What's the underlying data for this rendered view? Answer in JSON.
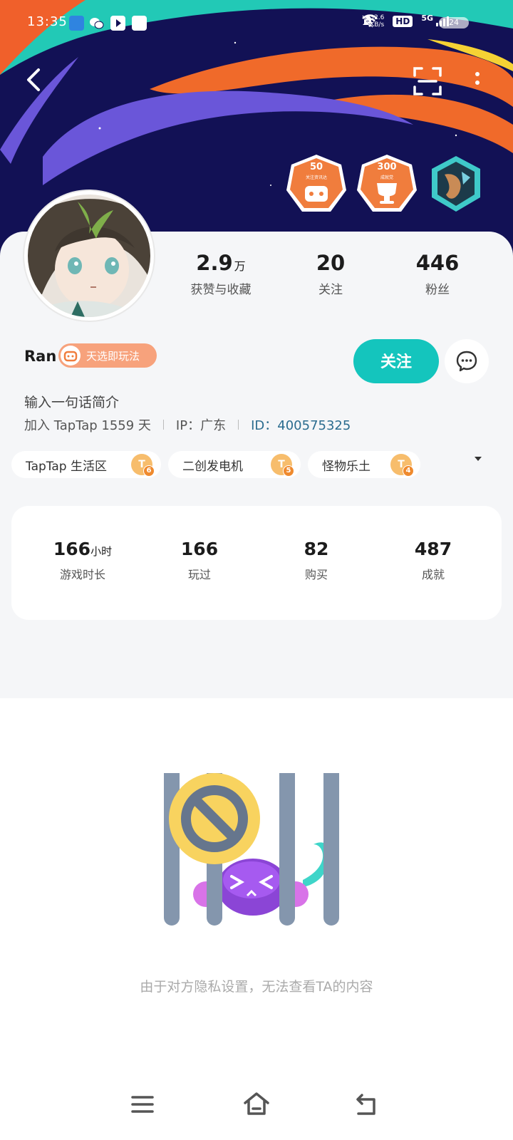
{
  "status_bar": {
    "time": "13:35",
    "net_speed_value": "32.6",
    "net_speed_unit": "KB/s",
    "hd_label": "HD",
    "network": "5G",
    "battery": "24"
  },
  "header": {
    "icons": {
      "back": "back-arrow-icon",
      "scan": "scan-icon",
      "more": "more-vertical-icon"
    },
    "badges": [
      {
        "number": "50",
        "subtitle": "关注资讯达",
        "icon": "controller-icon",
        "color": "#f07d3d"
      },
      {
        "number": "300",
        "subtitle": "成就党",
        "icon": "trophy-icon",
        "color": "#f07d3d"
      },
      {
        "icon": "character-medal-icon",
        "color": "#3fc9c9"
      }
    ]
  },
  "profile": {
    "stats": [
      {
        "value": "2.9",
        "unit": "万",
        "label": "获赞与收藏"
      },
      {
        "value": "20",
        "label": "关注"
      },
      {
        "value": "446",
        "label": "粉丝"
      }
    ],
    "name": "Ran",
    "title_badge": "天选即玩法",
    "follow_label": "关注",
    "bio": "输入一句话简介",
    "joined": "加入 TapTap 1559 天",
    "ip": "IP：广东",
    "user_id": "ID：400575325",
    "groups": [
      {
        "name": "TapTap 生活区",
        "level": "6"
      },
      {
        "name": "二创发电机",
        "level": "5"
      },
      {
        "name": "怪物乐土",
        "level": "4"
      }
    ],
    "game_stats": [
      {
        "value": "166",
        "unit": "小时",
        "label": "游戏时长"
      },
      {
        "value": "166",
        "label": "玩过"
      },
      {
        "value": "82",
        "label": "购买"
      },
      {
        "value": "487",
        "label": "成就"
      }
    ]
  },
  "privacy": {
    "message": "由于对方隐私设置，无法查看TA的内容"
  },
  "nav": {
    "icons": [
      "menu-icon",
      "home-icon",
      "back-icon"
    ]
  },
  "colors": {
    "accent": "#14c5bd",
    "banner_dark": "#121155",
    "badge_orange": "#f07d3d",
    "title_badge": "#f7a27c"
  }
}
